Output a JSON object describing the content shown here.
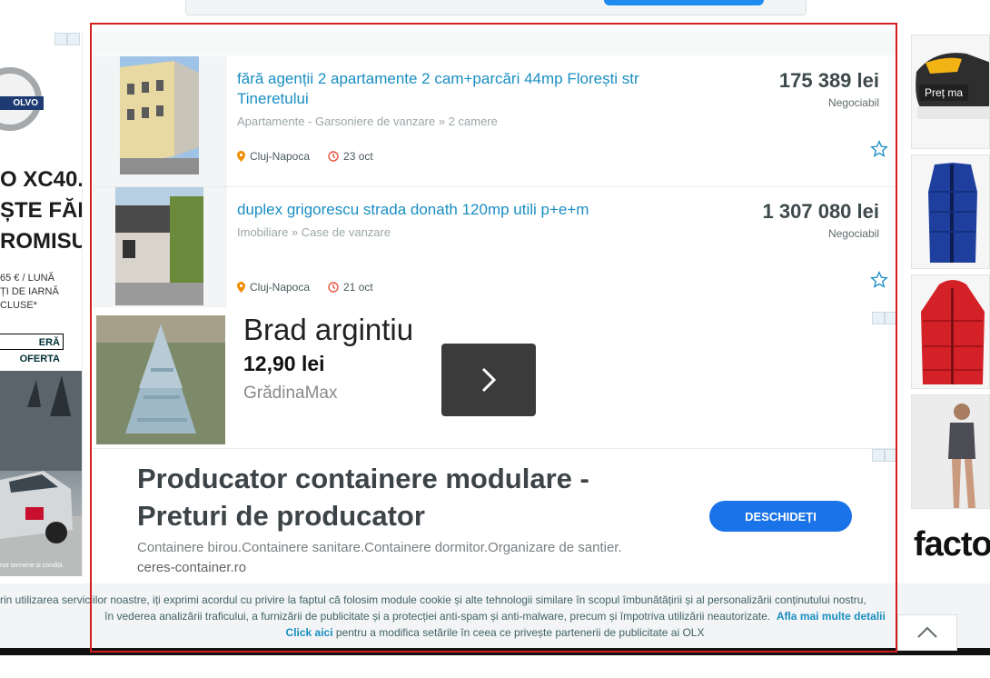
{
  "listings": [
    {
      "title": "fără agenții 2 apartamente 2 cam+parcări 44mp Florești str Tineretului",
      "category": "Apartamente - Garsoniere de vanzare » 2 camere",
      "location": "Cluj-Napoca",
      "date": "23 oct",
      "price": "175 389 lei",
      "negotiable": "Negociabil",
      "image_icon": "apartment-building-photo"
    },
    {
      "title": "duplex grigorescu strada donath 120mp utili p+e+m",
      "category": "Imobiliare » Case de vanzare",
      "location": "Cluj-Napoca",
      "date": "21 oct",
      "price": "1 307 080 lei",
      "negotiable": "Negociabil",
      "image_icon": "modern-house-photo"
    }
  ],
  "ad_product": {
    "title": "Brad argintiu",
    "price": "12,90 lei",
    "brand": "GrădinaMax"
  },
  "ad_text": {
    "title": "Producator containere modulare - Preturi de producator",
    "description": "Containere birou.Containere sanitare.Containere dormitor.Organizare de santier.",
    "url": "ceres-container.ro",
    "button": "DESCHIDEȚI"
  },
  "left_ad": {
    "logo": "OLVO",
    "headline_lines": [
      "O XC40.",
      "ȘTE FĂRĂ",
      "ROMISURI"
    ],
    "sub_lines": [
      "65 € / LUNĂ",
      "ȚI DE IARNĂ",
      "CLUSE*"
    ],
    "cta": "ERĂ OFERTA",
    "fine_print": "nor termene și condiții."
  },
  "right_ad": {
    "price_tag": "Preț ma",
    "brand": "facto"
  },
  "cookie": {
    "line1": "rin utilizarea serviciilor noastre, iți exprimi acordul cu privire la faptul că folosim module cookie și alte tehnologii similare în scopul îmbunătățirii și al personalizării conținutului nostru,",
    "line2": "în vederea analizării traficului, a furnizării de publicitate și a protecției anti-spam și anti-malware, precum și împotriva utilizării neautorizate.",
    "link_more": "Afla mai multe detalii",
    "link_click": "Click aici",
    "line3": "pentru a modifica setările în ceea ce privește partenerii de publicitate ai OLX"
  },
  "colors": {
    "link": "#1a8ec2",
    "ad_button": "#1a73e8",
    "frame": "#d21e1e"
  }
}
